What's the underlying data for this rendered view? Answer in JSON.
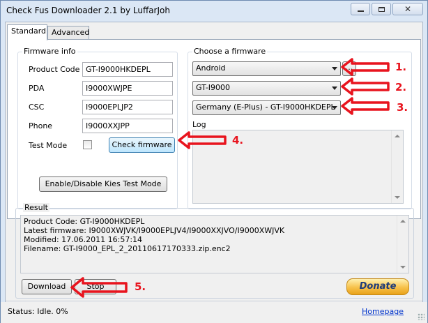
{
  "window": {
    "title": "Check Fus Downloader 2.1 by LuffarJoh",
    "min_icon": "minimize-icon",
    "max_icon": "maximize-icon",
    "close_icon": "close-icon"
  },
  "tabs": [
    {
      "label": "Standard",
      "active": true
    },
    {
      "label": "Advanced",
      "active": false
    }
  ],
  "firmware_info": {
    "group_label": "Firmware info",
    "product_code_label": "Product Code",
    "product_code_value": "GT-I9000HKDEPL",
    "pda_label": "PDA",
    "pda_value": "I9000XWJPE",
    "csc_label": "CSC",
    "csc_value": "I9000EPLJP2",
    "phone_label": "Phone",
    "phone_value": "I9000XXJPP",
    "test_mode_label": "Test Mode",
    "test_mode_checked": false,
    "check_button": "Check firmware",
    "kies_button": "Enable/Disable Kies Test Mode"
  },
  "choose_firmware": {
    "group_label": "Choose a firmware",
    "os_selected": "Android",
    "model_selected": "GT-I9000",
    "region_selected": "Germany (E-Plus) - GT-I9000HKDEPL",
    "browse_label": "..."
  },
  "log": {
    "label": "Log"
  },
  "result": {
    "group_label": "Result",
    "lines": [
      "Product Code: GT-I9000HKDEPL",
      "Latest firmware: I9000XWJVK/I9000EPLJV4/I9000XXJVO/I9000XWJVK",
      "Modified: 17.06.2011 16:57:14",
      "Filename: GT-I9000_EPL_2_20110617170333.zip.enc2"
    ]
  },
  "buttons": {
    "download": "Download",
    "stop": "Stop",
    "donate": "Donate"
  },
  "statusbar": {
    "status": "Status: Idle.  0%",
    "homepage": "Homepage"
  },
  "annotations": {
    "a1": "1.",
    "a2": "2.",
    "a3": "3.",
    "a4": "4.",
    "a5": "5.",
    "color": "#e8141e"
  }
}
